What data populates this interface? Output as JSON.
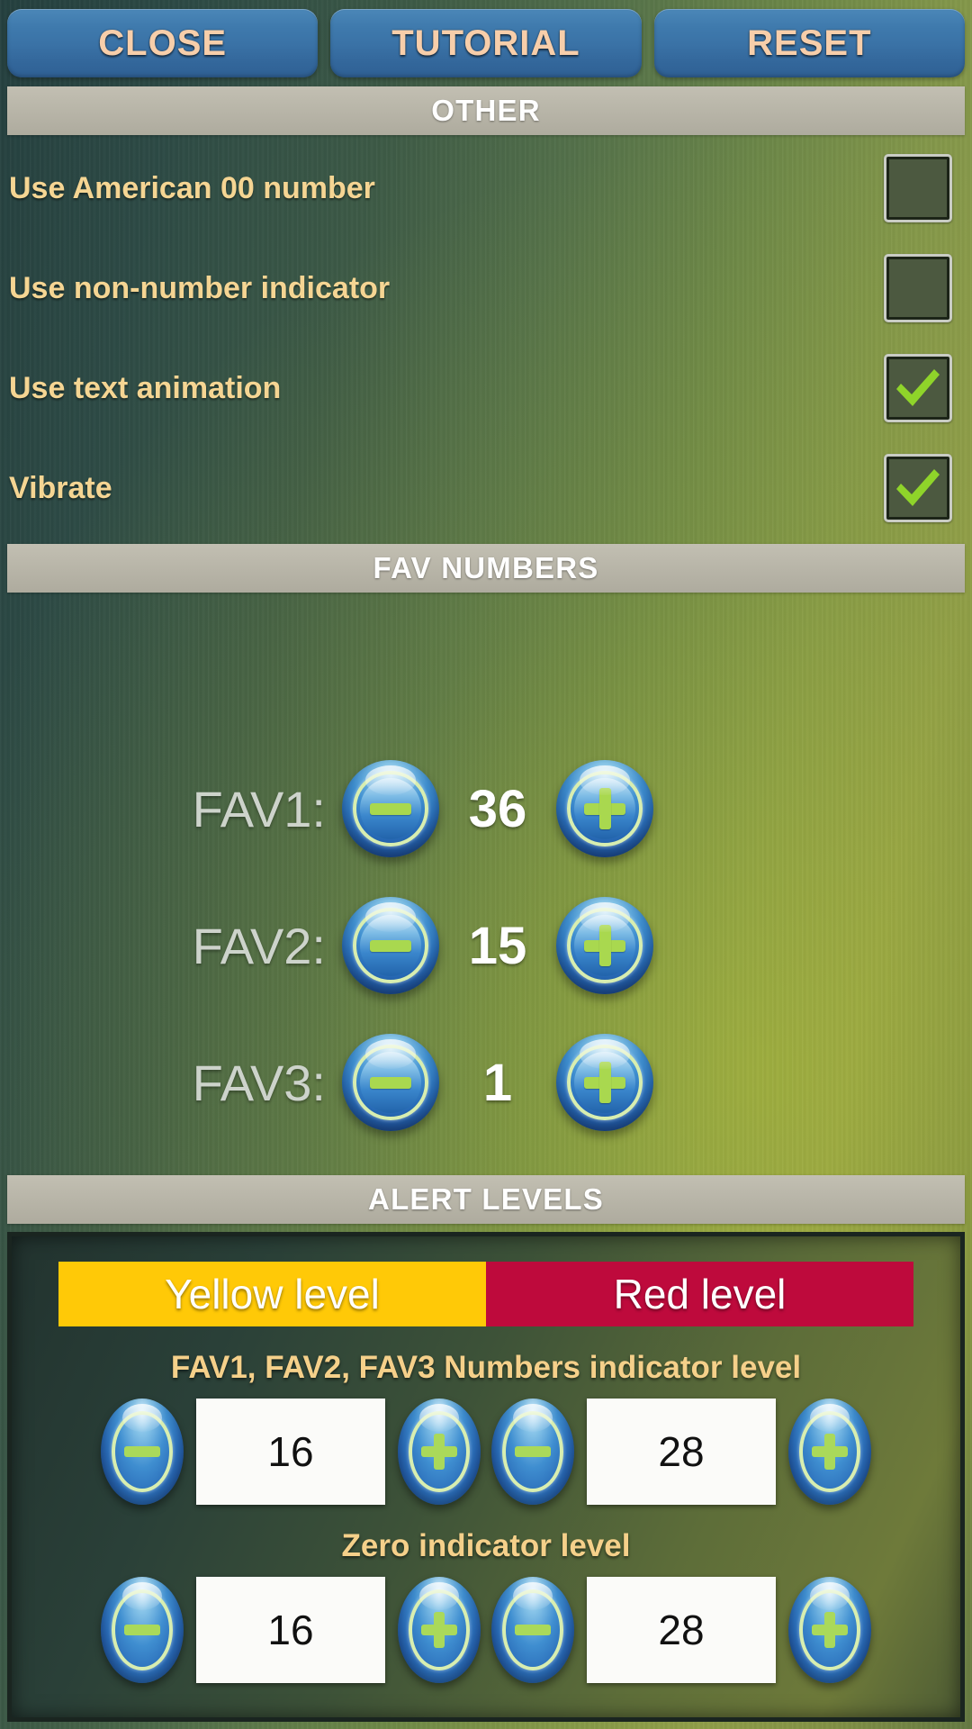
{
  "topbar": {
    "buttons": [
      {
        "label": "CLOSE",
        "name": "close-button"
      },
      {
        "label": "TUTORIAL",
        "name": "tutorial-button"
      },
      {
        "label": "RESET",
        "name": "reset-button"
      }
    ]
  },
  "sections": {
    "other": "OTHER",
    "fav_numbers": "FAV NUMBERS",
    "alert_levels": "ALERT LEVELS"
  },
  "other_options": [
    {
      "label": "Use American 00 number",
      "checked": false
    },
    {
      "label": "Use non-number indicator",
      "checked": false
    },
    {
      "label": "Use text animation",
      "checked": true
    },
    {
      "label": "Vibrate",
      "checked": true
    }
  ],
  "fav_numbers": [
    {
      "label": "FAV1:",
      "value": "36"
    },
    {
      "label": "FAV2:",
      "value": "15"
    },
    {
      "label": "FAV3:",
      "value": "1"
    }
  ],
  "alert_levels": {
    "tabs": [
      {
        "label": "Yellow level",
        "color": "#ffc907"
      },
      {
        "label": "Red level",
        "color": "#be0a3c"
      }
    ],
    "groups": [
      {
        "title": "FAV1, FAV2, FAV3 Numbers indicator level",
        "yellow_value": "16",
        "red_value": "28"
      },
      {
        "title": "Zero indicator level",
        "yellow_value": "16",
        "red_value": "28"
      }
    ]
  },
  "icons": {
    "minus": "minus-icon",
    "plus": "plus-icon",
    "check": "check-icon"
  },
  "colors": {
    "label_text": "#f5d593",
    "fav_label": "#cdd3cb",
    "checkmark": "#8fd42a",
    "button_text": "#f7ceaa",
    "yellow": "#ffc907",
    "red": "#be0a3c",
    "glyph_green": "#a9d84f"
  }
}
